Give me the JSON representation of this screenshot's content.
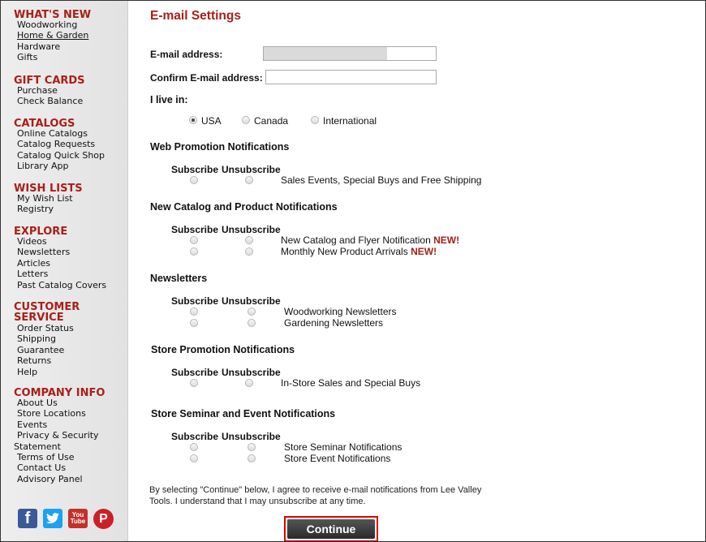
{
  "sidebar": {
    "sections": [
      {
        "title": "WHAT'S NEW",
        "items": [
          "Woodworking",
          "Home & Garden",
          "Hardware",
          "Gifts"
        ]
      },
      {
        "title": "GIFT CARDS",
        "items": [
          "Purchase",
          "Check Balance"
        ]
      },
      {
        "title": "CATALOGS",
        "items": [
          "Online Catalogs",
          "Catalog Requests",
          "Catalog Quick Shop",
          "Library App"
        ]
      },
      {
        "title": "WISH LISTS",
        "items": [
          "My Wish List",
          "Registry"
        ]
      },
      {
        "title": "EXPLORE",
        "items": [
          "Videos",
          "Newsletters",
          "Articles",
          "Letters",
          "Past Catalog Covers"
        ]
      },
      {
        "title": "CUSTOMER SERVICE",
        "items": [
          "Order Status",
          "Shipping",
          "Guarantee",
          "Returns",
          "Help"
        ]
      },
      {
        "title": "COMPANY INFO",
        "items": [
          "About Us",
          "Store Locations",
          "Events",
          "Privacy & Security",
          "Statement",
          "Terms of Use",
          "Contact Us",
          "Advisory Panel"
        ]
      }
    ],
    "social": [
      {
        "icon": "facebook-icon",
        "glyph": "f"
      },
      {
        "icon": "twitter-icon",
        "glyph": ""
      },
      {
        "icon": "youtube-icon",
        "glyph": "You Tube"
      },
      {
        "icon": "pinterest-icon",
        "glyph": "P"
      }
    ]
  },
  "page": {
    "title": "E-mail Settings",
    "email_label": "E-mail address:",
    "confirm_label": "Confirm E-mail address:",
    "live_label": "I live in:",
    "countries": [
      "USA",
      "Canada",
      "International"
    ],
    "selected_country": "USA"
  },
  "groups": [
    {
      "heading": "Web Promotion Notifications",
      "subscribe": "Subscribe",
      "unsubscribe": "Unsubscribe",
      "options": [
        {
          "label": "Sales Events, Special Buys and Free Shipping",
          "new": ""
        }
      ]
    },
    {
      "heading": "New Catalog and Product Notifications",
      "subscribe": "Subscribe",
      "unsubscribe": "Unsubscribe",
      "options": [
        {
          "label": "New Catalog and Flyer Notification",
          "new": "NEW!"
        },
        {
          "label": "Monthly New Product Arrivals",
          "new": "NEW!"
        }
      ]
    },
    {
      "heading": "Newsletters",
      "subscribe": "Subscribe",
      "unsubscribe": "Unsubscribe",
      "options": [
        {
          "label": "Woodworking Newsletters",
          "new": ""
        },
        {
          "label": "Gardening Newsletters",
          "new": ""
        }
      ]
    },
    {
      "heading": "Store Promotion Notifications",
      "subscribe": "Subscribe",
      "unsubscribe": "Unsubscribe",
      "options": [
        {
          "label": "In-Store Sales and Special Buys",
          "new": ""
        }
      ]
    },
    {
      "heading": "Store Seminar and Event Notifications",
      "subscribe": "Subscribe",
      "unsubscribe": "Unsubscribe",
      "options": [
        {
          "label": "Store Seminar Notifications",
          "new": ""
        },
        {
          "label": "Store Event Notifications",
          "new": ""
        }
      ]
    }
  ],
  "footer": {
    "agree_text": "By selecting \"Continue\" below, I agree to receive e-mail notifications from Lee Valley Tools. I understand that I may unsubscribe at any time.",
    "continue_label": "Continue"
  },
  "colors": {
    "accent": "#a8201a",
    "highlight": "#e00000"
  }
}
